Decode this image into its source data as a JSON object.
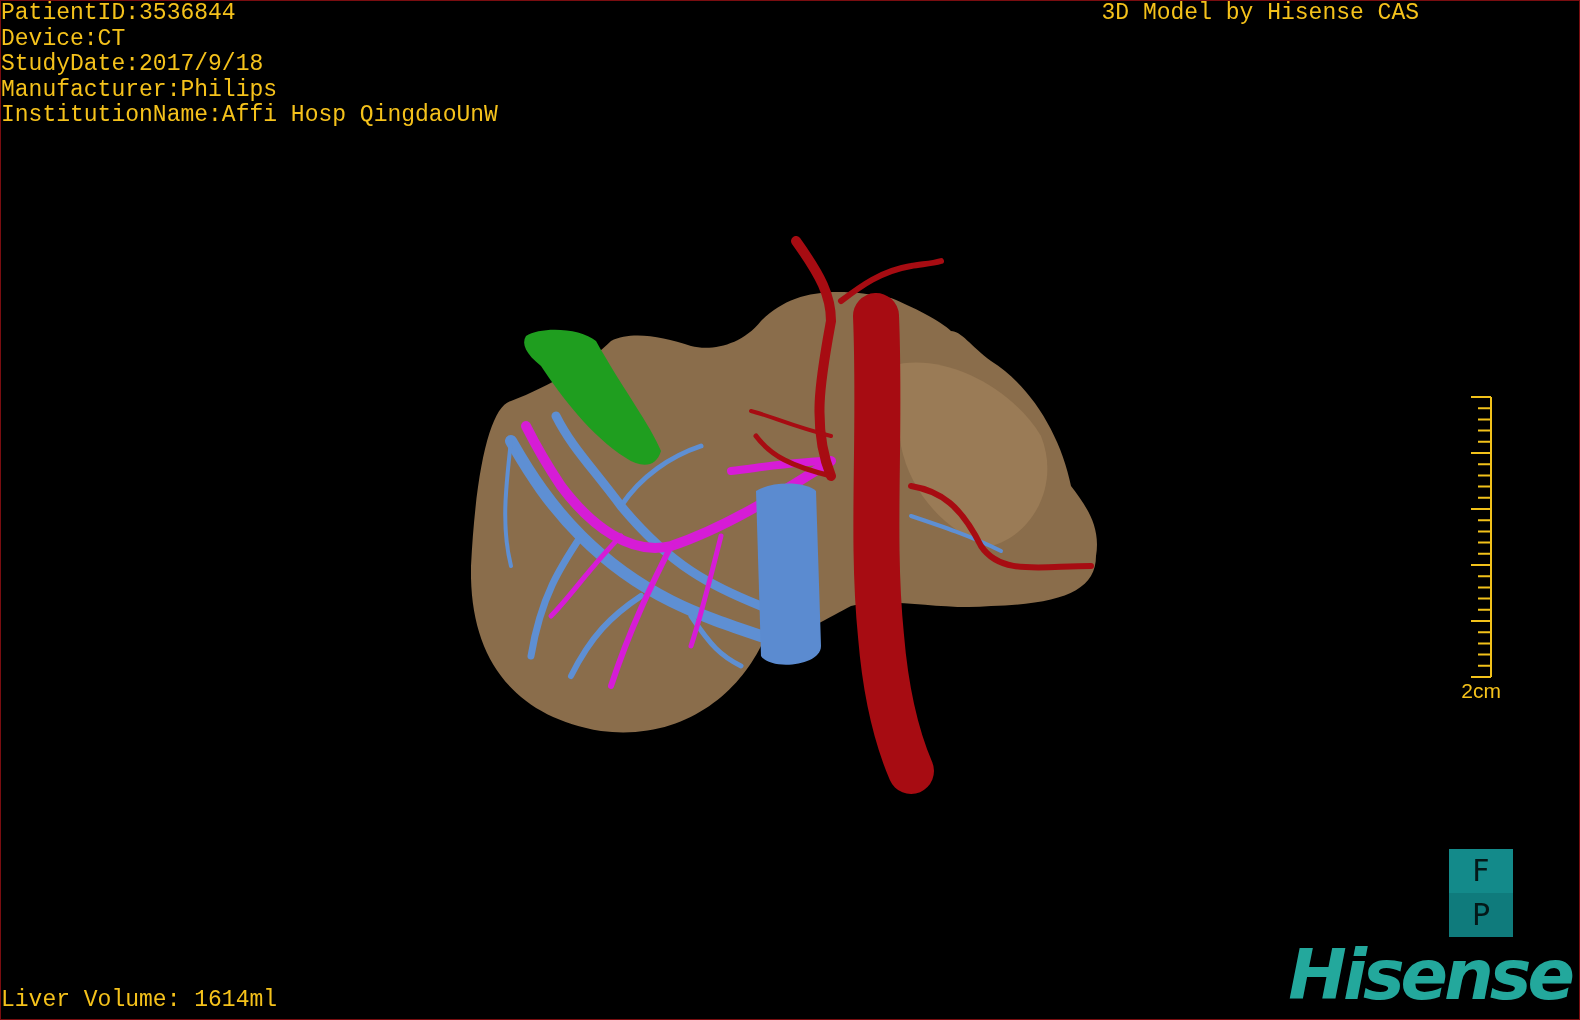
{
  "viewport": {
    "patient_info": [
      "PatientID:3536844",
      "Device:CT",
      "StudyDate:2017/9/18",
      "Manufacturer:Philips",
      "InstitutionName:Affi Hosp QingdaoUnW"
    ],
    "title": "3D Model by Hisense CAS",
    "scale_bar": {
      "label": "2cm"
    },
    "orientation_cube": {
      "top": "F",
      "bottom": "P"
    },
    "liver_volume": "Liver Volume: 1614ml",
    "logo": "Hisense"
  }
}
